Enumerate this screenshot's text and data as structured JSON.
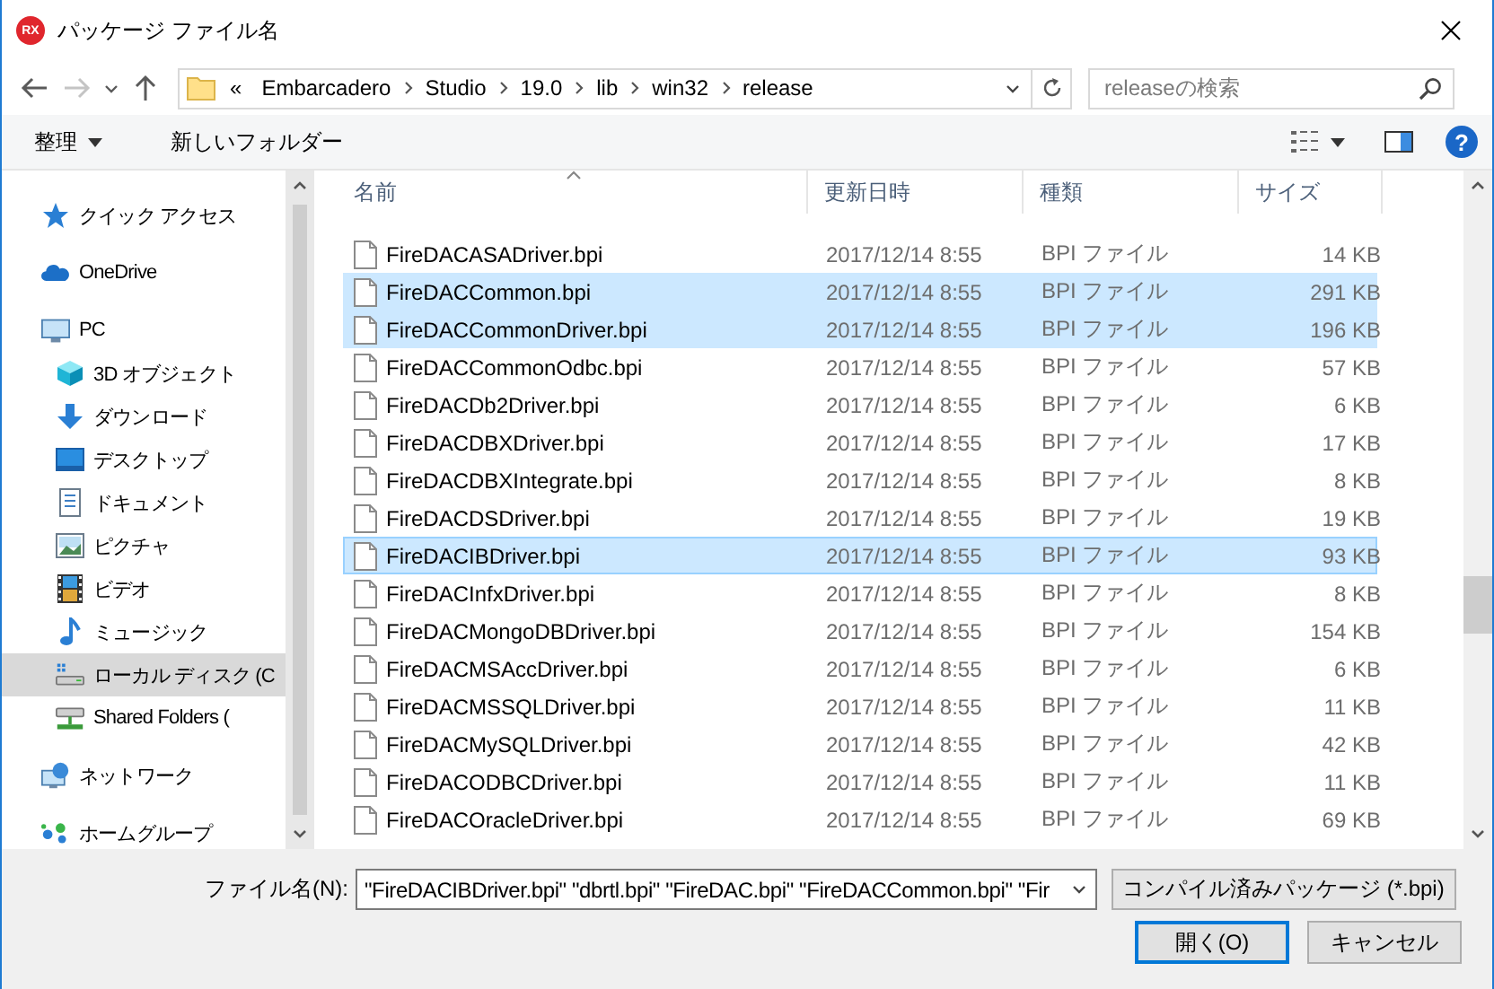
{
  "window": {
    "icon_text": "RX",
    "title": "パッケージ ファイル名"
  },
  "nav_buttons": [
    {
      "kind": "back",
      "disabled": false
    },
    {
      "kind": "forward",
      "disabled": true
    },
    {
      "kind": "recent",
      "disabled": false
    },
    {
      "kind": "up",
      "disabled": false
    }
  ],
  "address_bar": {
    "overflow": "«",
    "path": [
      "Embarcadero",
      "Studio",
      "19.0",
      "lib",
      "win32",
      "release"
    ]
  },
  "search": {
    "placeholder": "releaseの検索"
  },
  "toolbar": {
    "organize": "整理",
    "new_folder": "新しいフォルダー",
    "help": "?"
  },
  "sidebar": {
    "items": [
      {
        "kind": "quick",
        "label": "クイック アクセス",
        "selected": false
      },
      {
        "kind": "onedrive",
        "label": "OneDrive",
        "selected": false
      },
      {
        "kind": "pc",
        "label": "PC",
        "selected": false,
        "children": [
          {
            "kind": "objects3d",
            "label": "3D オブジェクト",
            "selected": false
          },
          {
            "kind": "downloads",
            "label": "ダウンロード",
            "selected": false
          },
          {
            "kind": "desktop",
            "label": "デスクトップ",
            "selected": false
          },
          {
            "kind": "documents",
            "label": "ドキュメント",
            "selected": false
          },
          {
            "kind": "pictures",
            "label": "ピクチャ",
            "selected": false
          },
          {
            "kind": "videos",
            "label": "ビデオ",
            "selected": false
          },
          {
            "kind": "music",
            "label": "ミュージック",
            "selected": false
          },
          {
            "kind": "disk",
            "label": "ローカル ディスク (C",
            "selected": true
          },
          {
            "kind": "shared",
            "label": "Shared Folders (",
            "selected": false
          }
        ]
      },
      {
        "kind": "network",
        "label": "ネットワーク",
        "selected": false
      },
      {
        "kind": "homegroup",
        "label": "ホームグループ",
        "selected": false
      }
    ]
  },
  "table": {
    "columns": [
      "名前",
      "更新日時",
      "種類",
      "サイズ"
    ],
    "rows": [
      {
        "name": "FireDACASADriver.bpi",
        "date": "2017/12/14 8:55",
        "type": "BPI ファイル",
        "size": "14 KB",
        "selected": false,
        "focused": false
      },
      {
        "name": "FireDACCommon.bpi",
        "date": "2017/12/14 8:55",
        "type": "BPI ファイル",
        "size": "291 KB",
        "selected": true,
        "focused": false
      },
      {
        "name": "FireDACCommonDriver.bpi",
        "date": "2017/12/14 8:55",
        "type": "BPI ファイル",
        "size": "196 KB",
        "selected": true,
        "focused": false
      },
      {
        "name": "FireDACCommonOdbc.bpi",
        "date": "2017/12/14 8:55",
        "type": "BPI ファイル",
        "size": "57 KB",
        "selected": false,
        "focused": false
      },
      {
        "name": "FireDACDb2Driver.bpi",
        "date": "2017/12/14 8:55",
        "type": "BPI ファイル",
        "size": "6 KB",
        "selected": false,
        "focused": false
      },
      {
        "name": "FireDACDBXDriver.bpi",
        "date": "2017/12/14 8:55",
        "type": "BPI ファイル",
        "size": "17 KB",
        "selected": false,
        "focused": false
      },
      {
        "name": "FireDACDBXIntegrate.bpi",
        "date": "2017/12/14 8:55",
        "type": "BPI ファイル",
        "size": "8 KB",
        "selected": false,
        "focused": false
      },
      {
        "name": "FireDACDSDriver.bpi",
        "date": "2017/12/14 8:55",
        "type": "BPI ファイル",
        "size": "19 KB",
        "selected": false,
        "focused": false
      },
      {
        "name": "FireDACIBDriver.bpi",
        "date": "2017/12/14 8:55",
        "type": "BPI ファイル",
        "size": "93 KB",
        "selected": true,
        "focused": true
      },
      {
        "name": "FireDACInfxDriver.bpi",
        "date": "2017/12/14 8:55",
        "type": "BPI ファイル",
        "size": "8 KB",
        "selected": false,
        "focused": false
      },
      {
        "name": "FireDACMongoDBDriver.bpi",
        "date": "2017/12/14 8:55",
        "type": "BPI ファイル",
        "size": "154 KB",
        "selected": false,
        "focused": false
      },
      {
        "name": "FireDACMSAccDriver.bpi",
        "date": "2017/12/14 8:55",
        "type": "BPI ファイル",
        "size": "6 KB",
        "selected": false,
        "focused": false
      },
      {
        "name": "FireDACMSSQLDriver.bpi",
        "date": "2017/12/14 8:55",
        "type": "BPI ファイル",
        "size": "11 KB",
        "selected": false,
        "focused": false
      },
      {
        "name": "FireDACMySQLDriver.bpi",
        "date": "2017/12/14 8:55",
        "type": "BPI ファイル",
        "size": "42 KB",
        "selected": false,
        "focused": false
      },
      {
        "name": "FireDACODBCDriver.bpi",
        "date": "2017/12/14 8:55",
        "type": "BPI ファイル",
        "size": "11 KB",
        "selected": false,
        "focused": false
      },
      {
        "name": "FireDACOracleDriver.bpi",
        "date": "2017/12/14 8:55",
        "type": "BPI ファイル",
        "size": "69 KB",
        "selected": false,
        "focused": false
      }
    ]
  },
  "footer": {
    "file_name_label": "ファイル名(N):",
    "file_name_value": "\"FireDACIBDriver.bpi\" \"dbrtl.bpi\" \"FireDAC.bpi\" \"FireDACCommon.bpi\" \"Fir",
    "filter": "コンパイル済みパッケージ (*.bpi)",
    "buttons": [
      {
        "label": "開く(O)",
        "default": true
      },
      {
        "label": "キャンセル",
        "default": false
      }
    ]
  }
}
